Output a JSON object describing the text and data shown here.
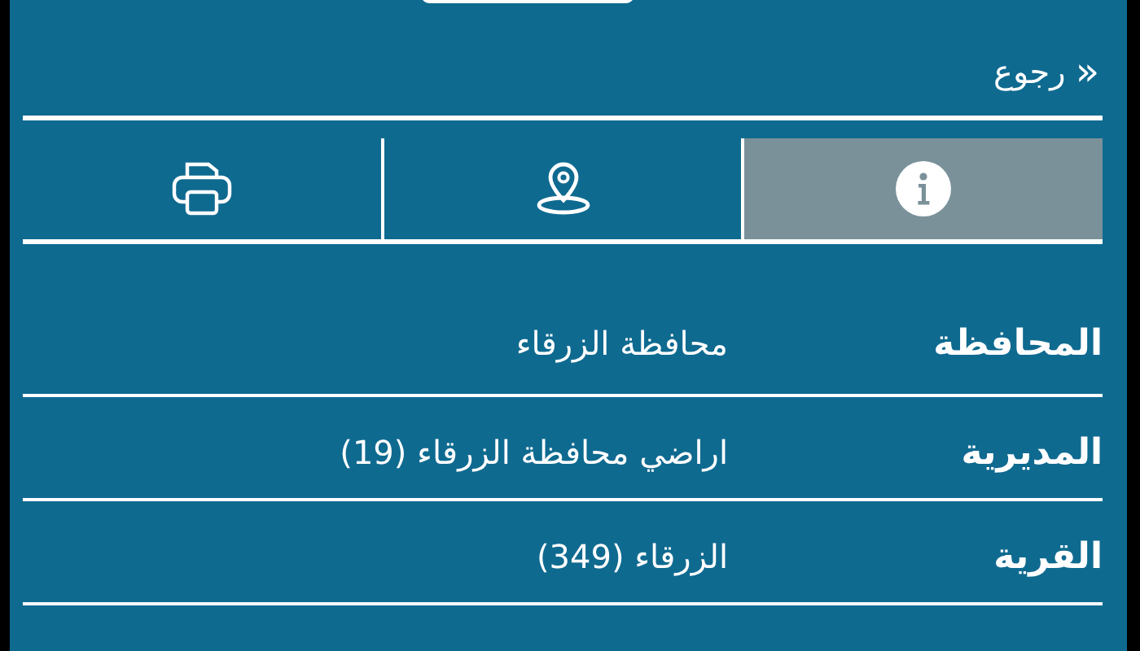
{
  "back": {
    "label": "رجوع",
    "icon": "«"
  },
  "tabs": [
    {
      "kind": "info",
      "selected": true
    },
    {
      "kind": "location",
      "selected": false
    },
    {
      "kind": "print",
      "selected": false
    }
  ],
  "details": [
    {
      "label": "المحافظة",
      "value": "محافظة الزرقاء"
    },
    {
      "label": "المديرية",
      "value": "اراضي محافظة الزرقاء (19)"
    },
    {
      "label": "القرية",
      "value": "الزرقاء (349)"
    }
  ]
}
